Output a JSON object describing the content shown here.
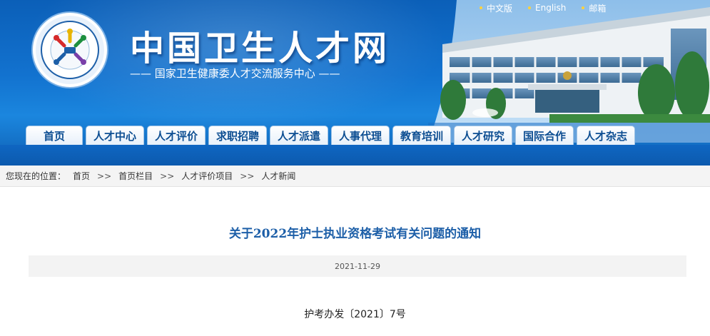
{
  "top_links": [
    {
      "label": "中文版"
    },
    {
      "label": "English"
    },
    {
      "label": "邮箱"
    }
  ],
  "header": {
    "title": "中国卫生人才网",
    "subtitle": "—— 国家卫生健康委人才交流服务中心 ——",
    "logo_text": "国家卫生健康委人才交流服务中心"
  },
  "nav": [
    {
      "label": "首页"
    },
    {
      "label": "人才中心"
    },
    {
      "label": "人才评价"
    },
    {
      "label": "求职招聘"
    },
    {
      "label": "人才派遣"
    },
    {
      "label": "人事代理"
    },
    {
      "label": "教育培训"
    },
    {
      "label": "人才研究"
    },
    {
      "label": "国际合作"
    },
    {
      "label": "人才杂志"
    }
  ],
  "breadcrumb": {
    "prefix": "您现在的位置：",
    "items": [
      "首页",
      "首页栏目",
      "人才评价项目",
      "人才新闻"
    ],
    "separator": ">>"
  },
  "article": {
    "title": "关于2022年护士执业资格考试有关问题的通知",
    "date": "2021-11-29",
    "doc_number": "护考办发〔2021〕7号"
  },
  "colors": {
    "banner_blue": "#1272cf",
    "nav_text": "#0d4e92",
    "title_blue": "#1d5fa8",
    "link_dot": "#ffd23a"
  }
}
